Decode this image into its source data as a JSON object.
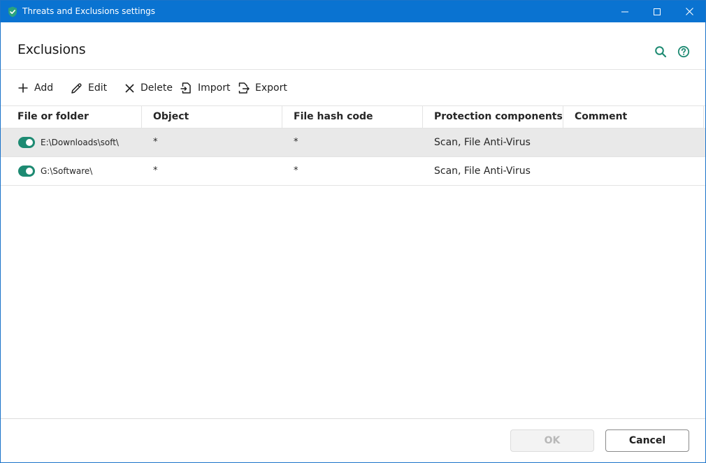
{
  "window": {
    "title": "Threats and Exclusions settings",
    "accent_color": "#0a73d1",
    "brand_color": "#1d8a72"
  },
  "header": {
    "title": "Exclusions",
    "icons": [
      "search-icon",
      "help-icon"
    ]
  },
  "toolbar": {
    "add_label": "Add",
    "edit_label": "Edit",
    "delete_label": "Delete",
    "import_label": "Import",
    "export_label": "Export"
  },
  "table": {
    "columns": [
      "File or folder",
      "Object",
      "File hash code",
      "Protection components",
      "Comment"
    ],
    "rows": [
      {
        "enabled": true,
        "path": "E:\\Downloads\\soft\\",
        "object": "*",
        "hash": "*",
        "components": "Scan, File Anti-Virus",
        "comment": ""
      },
      {
        "enabled": true,
        "path": "G:\\Software\\",
        "object": "*",
        "hash": "*",
        "components": "Scan, File Anti-Virus",
        "comment": ""
      }
    ]
  },
  "footer": {
    "ok_label": "OK",
    "cancel_label": "Cancel"
  }
}
